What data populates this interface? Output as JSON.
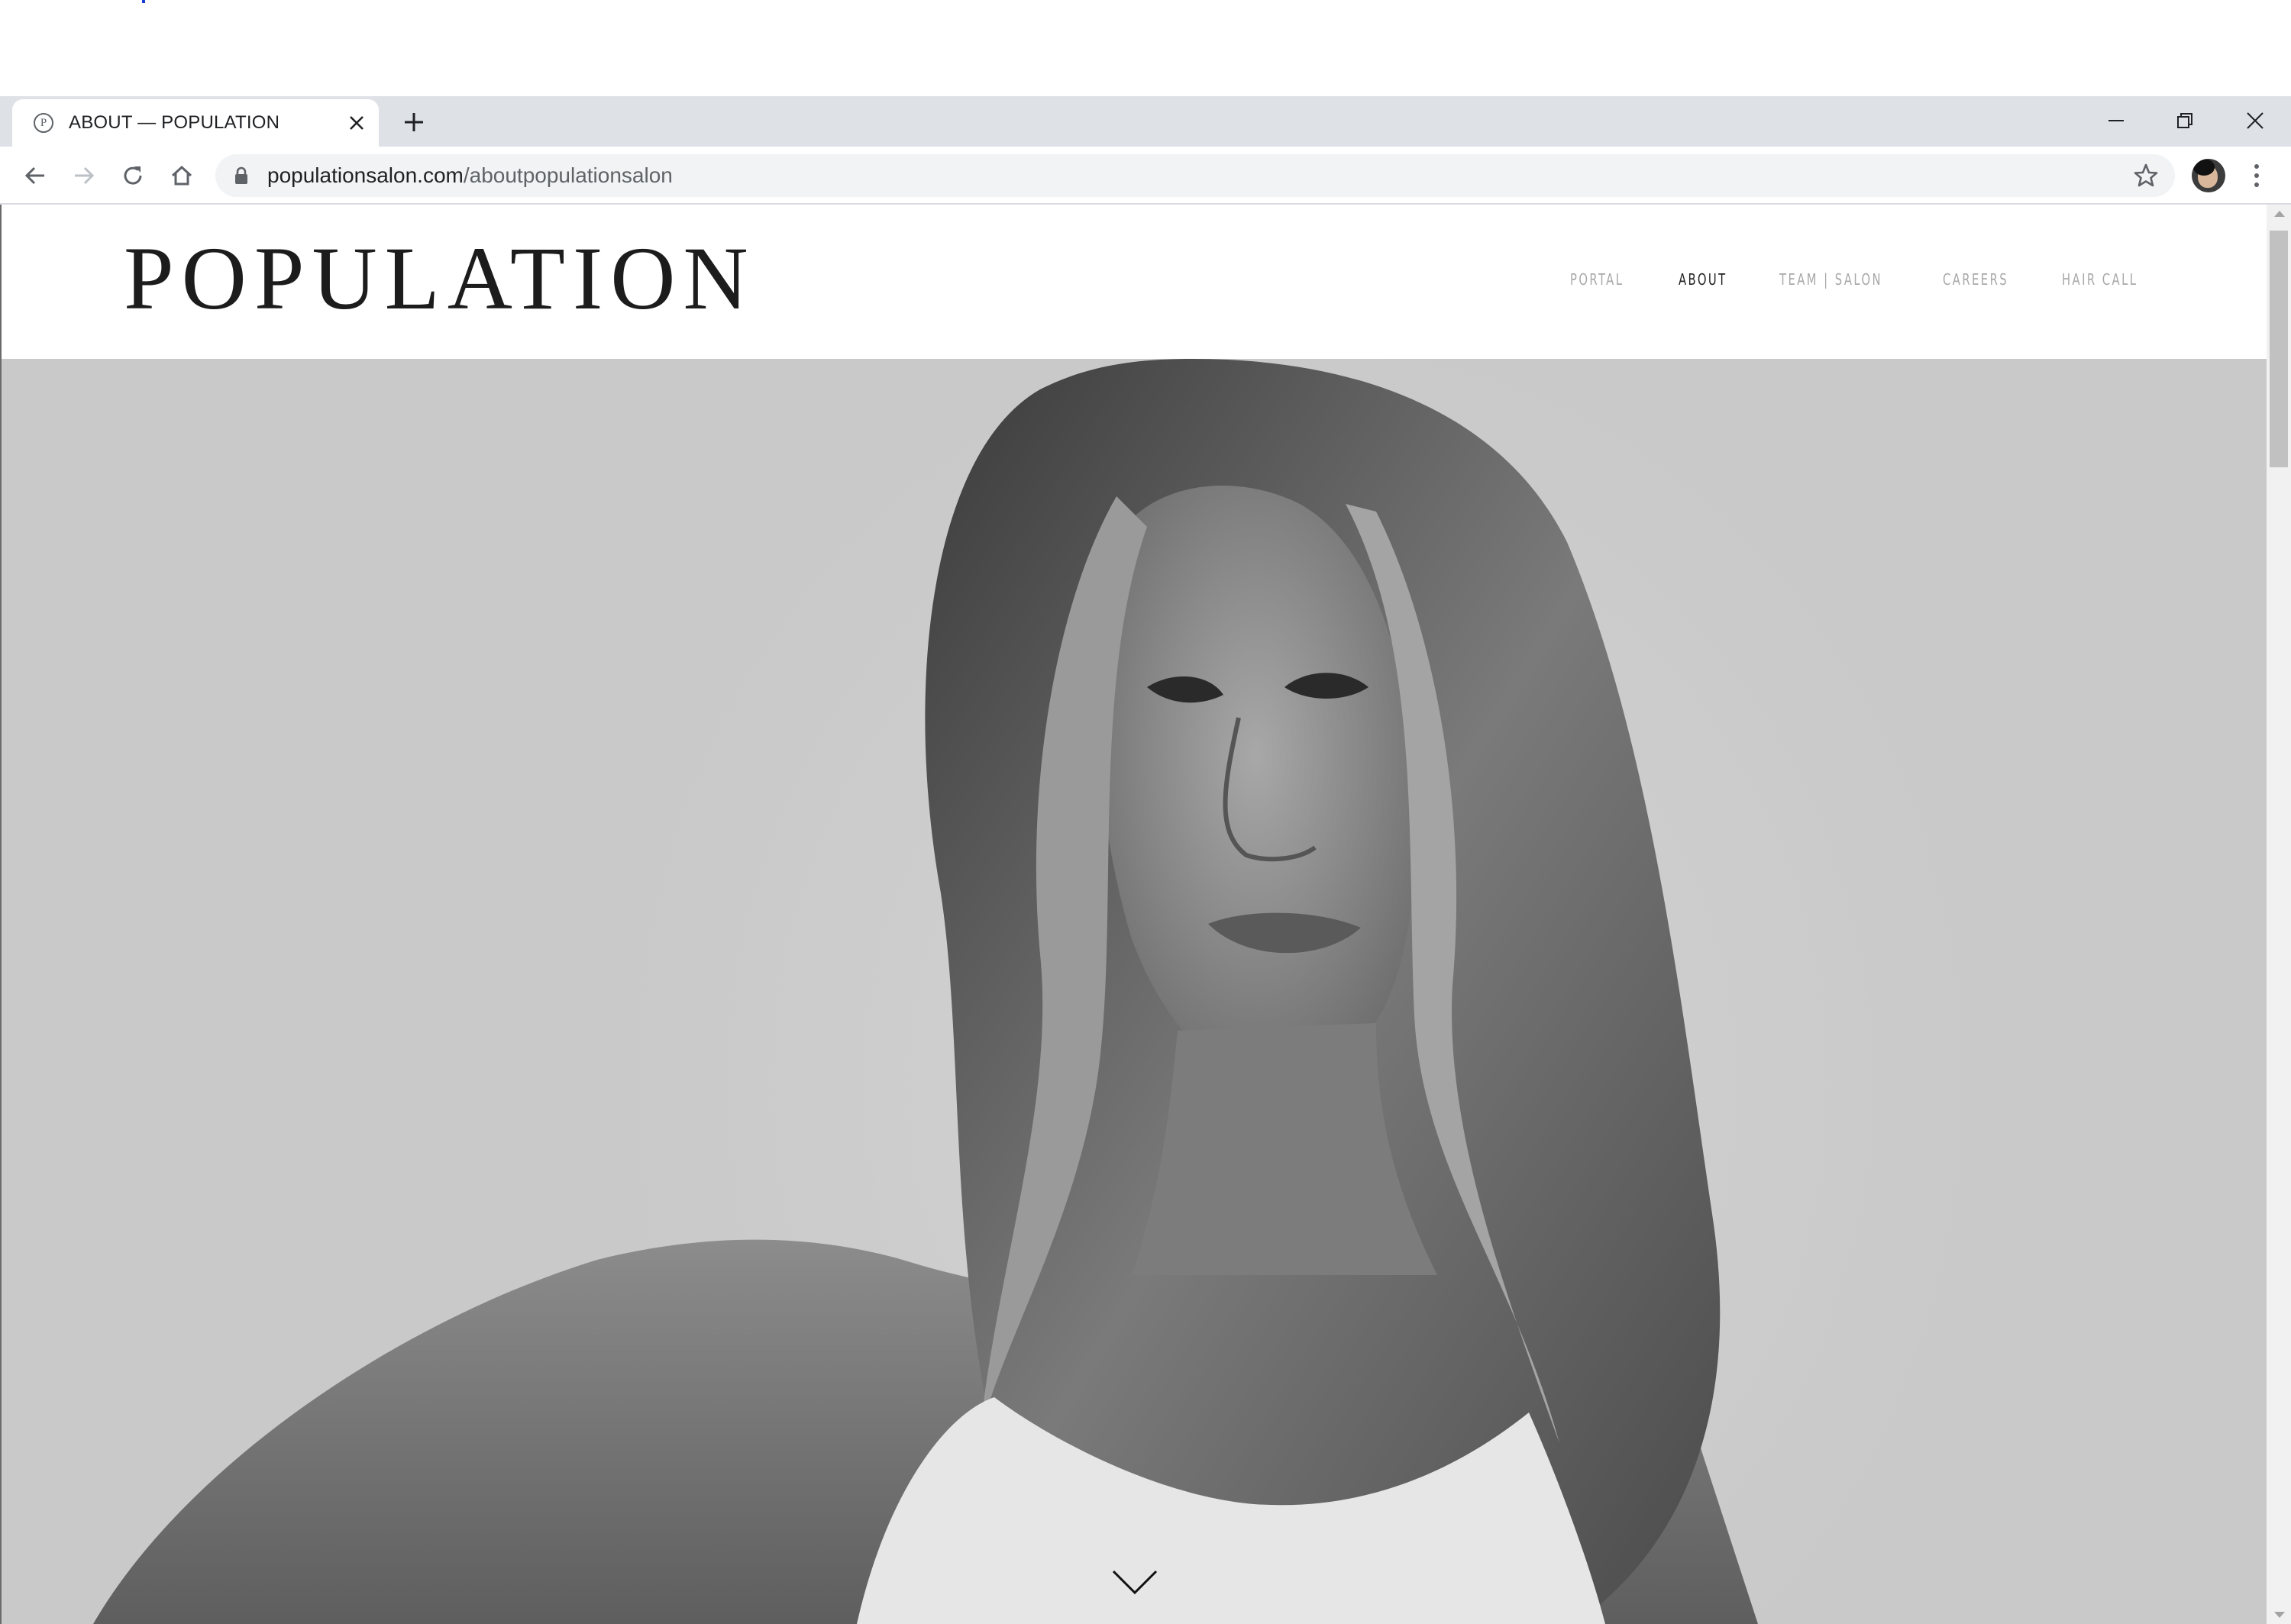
{
  "browser": {
    "tab": {
      "title": "ABOUT — POPULATION",
      "favicon_letter": "P"
    },
    "url": {
      "domain": "populationsalon.com",
      "path": "/aboutpopulationsalon"
    }
  },
  "site": {
    "logo": "POPULATION",
    "nav": [
      {
        "label": "PORTAL",
        "active": false
      },
      {
        "label": "ABOUT",
        "active": true
      },
      {
        "label": "TEAM | SALON",
        "active": false
      },
      {
        "label": "CAREERS",
        "active": false
      },
      {
        "label": "HAIR CALL",
        "active": false
      }
    ]
  },
  "colors": {
    "chrome_tabstrip": "#dee1e6",
    "omnibox": "#f1f3f4",
    "nav_inactive": "#a8a8a8",
    "nav_active": "#222222",
    "logo": "#1c1c1c"
  },
  "icons": [
    "favicon-icon",
    "close-tab-icon",
    "new-tab-icon",
    "minimize-icon",
    "restore-icon",
    "close-window-icon",
    "back-icon",
    "forward-icon",
    "reload-icon",
    "home-icon",
    "lock-icon",
    "bookmark-star-icon",
    "profile-avatar",
    "menu-icon",
    "chevron-down-icon"
  ]
}
